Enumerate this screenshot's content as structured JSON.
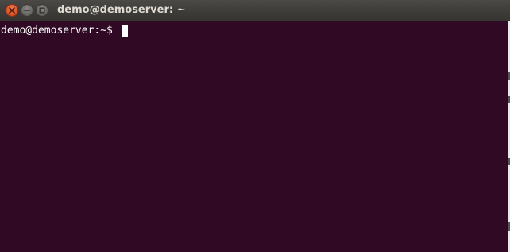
{
  "window": {
    "title": "demo@demoserver: ~",
    "controls": {
      "close_icon": "close-icon",
      "minimize_icon": "minimize-icon",
      "maximize_icon": "maximize-icon"
    }
  },
  "terminal": {
    "prompt": "demo@demoserver:~$",
    "command_input": "",
    "background_color": "#300a24",
    "text_color": "#ffffff"
  },
  "colors": {
    "titlebar": "#3d3c38",
    "close_button": "#e0582a",
    "title_text": "#dfdbd2"
  }
}
